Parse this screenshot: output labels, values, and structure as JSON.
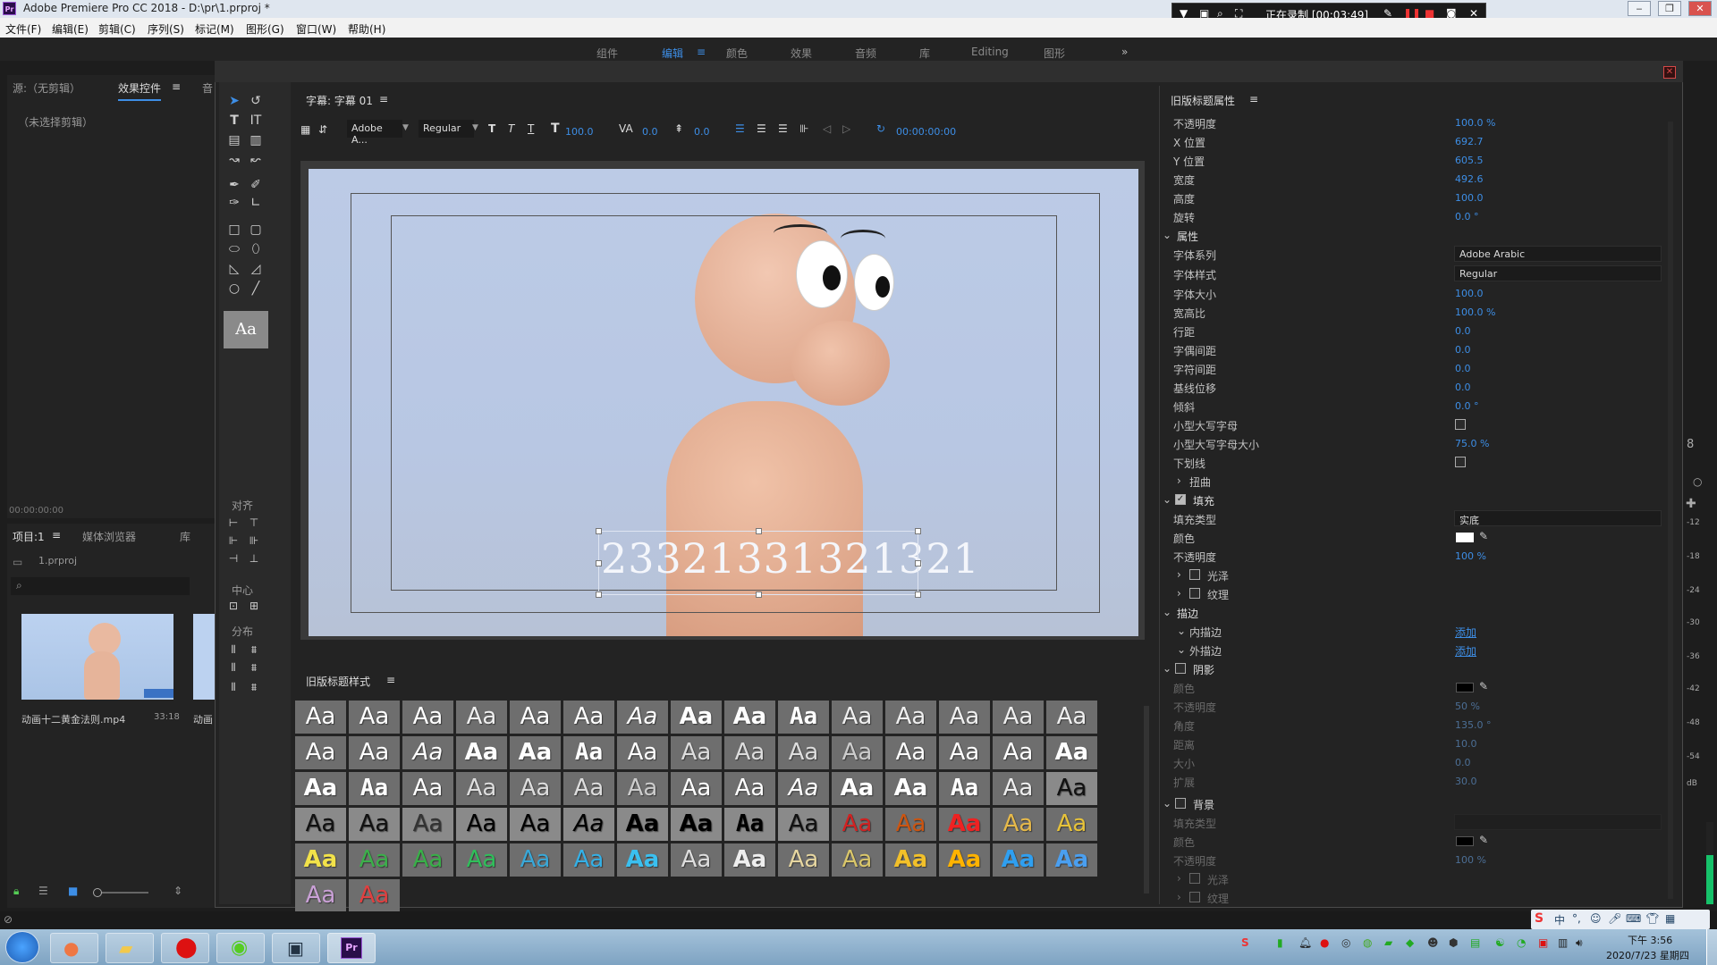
{
  "window": {
    "title": "Adobe Premiere Pro CC 2018 - D:\\pr\\1.prproj *"
  },
  "recorder": {
    "status": "正在录制 [00:03:49]"
  },
  "menu": [
    "文件(F)",
    "编辑(E)",
    "剪辑(C)",
    "序列(S)",
    "标记(M)",
    "图形(G)",
    "窗口(W)",
    "帮助(H)"
  ],
  "workspaces": [
    "组件",
    "编辑",
    "颜色",
    "效果",
    "音频",
    "库",
    "Editing",
    "图形"
  ],
  "source_panel": {
    "tab1": "源:（无剪辑）",
    "tab2": "效果控件",
    "tab3": "音",
    "placeholder": "（未选择剪辑）",
    "timecode": "00:00:00:00"
  },
  "project_panel": {
    "tab1": "项目:1",
    "tab2": "媒体浏览器",
    "tab3": "库",
    "project_file": "1.prproj",
    "clip_name": "动画十二黄金法则.mp4",
    "clip_duration": "33:18",
    "clip2_name": "动画"
  },
  "titler": {
    "panel_title": "字幕: 字幕 01",
    "font_family": "Adobe A...",
    "font_style": "Regular",
    "font_size": "100.0",
    "kerning": "0.0",
    "leading": "0.0",
    "timecode": "00:00:00:00",
    "subtitle_text": "23321331321321",
    "align_label": "对齐",
    "center_label": "中心",
    "distribute_label": "分布",
    "tool_preview": "Aa"
  },
  "styles_panel": {
    "title": "旧版标题样式",
    "swatch_text": "Aa"
  },
  "properties": {
    "title": "旧版标题属性",
    "rows": [
      {
        "label": "不透明度",
        "value": "100.0 %"
      },
      {
        "label": "X 位置",
        "value": "692.7"
      },
      {
        "label": "Y 位置",
        "value": "605.5"
      },
      {
        "label": "宽度",
        "value": "492.6"
      },
      {
        "label": "高度",
        "value": "100.0"
      },
      {
        "label": "旋转",
        "value": "0.0 °"
      }
    ],
    "section_attr": "属性",
    "font_family_label": "字体系列",
    "font_family": "Adobe Arabic",
    "font_style_label": "字体样式",
    "font_style": "Regular",
    "attr_rows": [
      {
        "label": "字体大小",
        "value": "100.0"
      },
      {
        "label": "宽高比",
        "value": "100.0 %"
      },
      {
        "label": "行距",
        "value": "0.0"
      },
      {
        "label": "字偶间距",
        "value": "0.0"
      },
      {
        "label": "字符间距",
        "value": "0.0"
      },
      {
        "label": "基线位移",
        "value": "0.0"
      },
      {
        "label": "倾斜",
        "value": "0.0 °"
      }
    ],
    "small_caps_label": "小型大写字母",
    "small_caps_size_label": "小型大写字母大小",
    "small_caps_size": "75.0 %",
    "underline_label": "下划线",
    "distort_label": "扭曲",
    "fill_label": "填充",
    "fill_type_label": "填充类型",
    "fill_type": "实底",
    "color_label": "颜色",
    "opacity_label": "不透明度",
    "opacity": "100 %",
    "sheen_label": "光泽",
    "texture_label": "纹理",
    "stroke_label": "描边",
    "inner_stroke_label": "内描边",
    "outer_stroke_label": "外描边",
    "add_label": "添加",
    "shadow_label": "阴影",
    "shadow_rows": [
      {
        "label": "颜色",
        "value": ""
      },
      {
        "label": "不透明度",
        "value": "50 %"
      },
      {
        "label": "角度",
        "value": "135.0 °"
      },
      {
        "label": "距离",
        "value": "10.0"
      },
      {
        "label": "大小",
        "value": "0.0"
      },
      {
        "label": "扩展",
        "value": "30.0"
      }
    ],
    "background_label": "背景",
    "bg_rows": [
      {
        "label": "填充类型",
        "value": ""
      },
      {
        "label": "颜色",
        "value": ""
      },
      {
        "label": "不透明度",
        "value": "100 %"
      }
    ]
  },
  "audio_meter": {
    "labels": [
      "8",
      "-12",
      "-18",
      "-24",
      "-30",
      "-36",
      "-42",
      "-48",
      "-54",
      "dB"
    ]
  },
  "clock": {
    "time": "下午 3:56",
    "date": "2020/7/23 星期四"
  },
  "colors": {
    "accent": "#3d8ee6",
    "bg": "#232323",
    "canvas": "#bccbe6"
  }
}
